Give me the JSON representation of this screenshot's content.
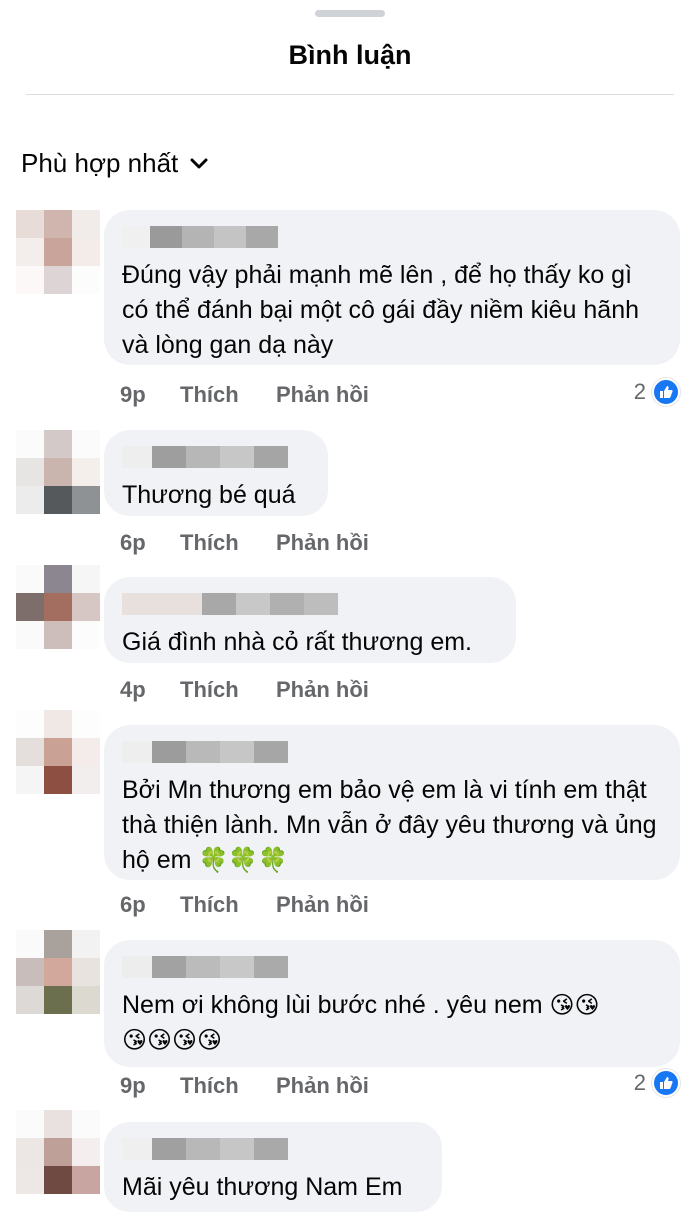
{
  "header": {
    "title": "Bình luận"
  },
  "sort": {
    "label": "Phù hợp nhất"
  },
  "actions": {
    "like_label": "Thích",
    "reply_label": "Phản hồi"
  },
  "comments": [
    {
      "text": "Đúng vậy phải mạnh mẽ lên , để họ thấy ko gì có thể đánh bại một cô gái đầy niềm kiêu hãnh và lòng gan dạ này",
      "time": "9p",
      "reactions": "2"
    },
    {
      "text": "Thương bé quá",
      "time": "6p"
    },
    {
      "text": "Giá đình nhà cỏ rất thương em.",
      "time": "4p"
    },
    {
      "text": "Bởi Mn thương em bảo vệ em là vi tính em thật thà thiện lành. Mn vẫn ở đây yêu thương và ủng hộ em",
      "emoji": "🍀🍀🍀",
      "time": "6p"
    },
    {
      "text": "Nem ơi không lùi bước nhé . yêu nem",
      "emoji": "😘😘",
      "emoji_line2": "😘😘😘😘",
      "time": "9p",
      "reactions": "2"
    },
    {
      "text": "Mãi yêu thương Nam Em"
    }
  ],
  "colors": {
    "accent": "#1877f2",
    "bubble": "#f0f2f5",
    "muted": "#65676b"
  }
}
